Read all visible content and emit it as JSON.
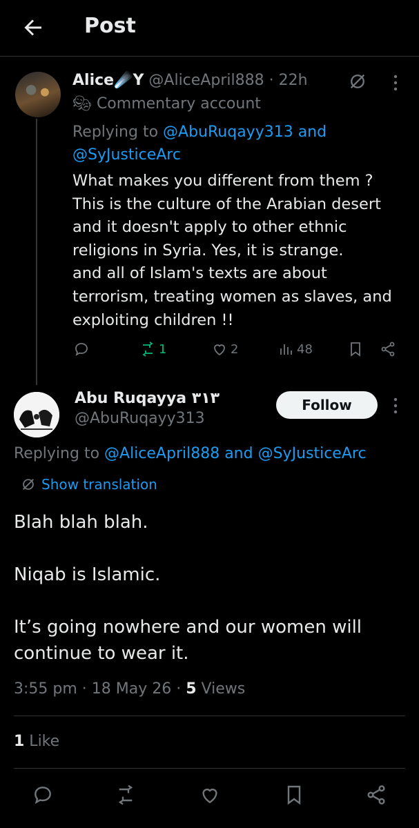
{
  "header": {
    "title": "Post"
  },
  "parent_post": {
    "display_name": "Alice☄️Y",
    "handle": "@AliceApril888",
    "time": "· 22h",
    "label": "Commentary account",
    "replying_prefix": "Replying to ",
    "replying_link": "@AbuRuqayy313 and @SyJusticeArc",
    "text": "What makes you different from them ?\nThis is the culture of the Arabian desert and it doesn't apply to other ethnic religions in Syria. Yes, it is strange.\n and all of Islam's texts are about terrorism, treating women as slaves, and exploiting children !!",
    "reposts": "1",
    "likes": "2",
    "views": "48"
  },
  "main_post": {
    "display_name": "Abu Ruqayya ٣١٣",
    "handle": "@AbuRuqayy313",
    "follow_label": "Follow",
    "replying_prefix": "Replying to ",
    "replying_link": "@AliceApril888 and @SyJusticeArc",
    "show_translation": "Show translation",
    "text": "Blah blah blah.\n\nNiqab is Islamic.\n\nIt’s going nowhere and our women will continue to wear it.",
    "time": "3:55 pm · 18 May 26 · ",
    "views_count": "5",
    "views_label": " Views",
    "likes_count": "1",
    "likes_label": " Like"
  },
  "colors": {
    "background": "#000000",
    "text": "#e7e9ea",
    "muted": "#71767b",
    "link": "#1d9bf0",
    "repost_active": "#00ba7c"
  }
}
